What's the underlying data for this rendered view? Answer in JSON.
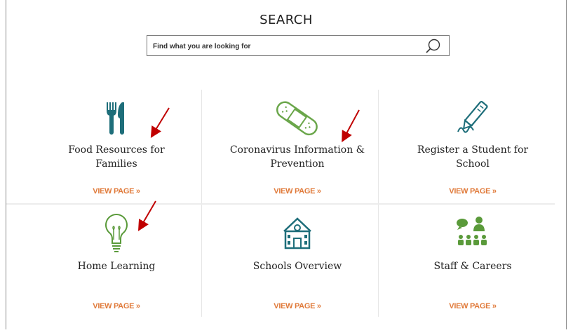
{
  "search": {
    "heading": "SEARCH",
    "placeholder": "Find what you are looking for"
  },
  "tiles": [
    {
      "title_line1": "Food Resources for",
      "title_line2": "Families",
      "link": "VIEW PAGE »",
      "icon": "utensils-icon"
    },
    {
      "title_line1": "Coronavirus Information &",
      "title_line2": "Prevention",
      "link": "VIEW PAGE »",
      "icon": "bandage-icon"
    },
    {
      "title_line1": "Register a Student for",
      "title_line2": "School",
      "link": "VIEW PAGE »",
      "icon": "pen-icon"
    },
    {
      "title_line1": "Home Learning",
      "title_line2": "",
      "link": "VIEW PAGE »",
      "icon": "lightbulb-icon"
    },
    {
      "title_line1": "Schools Overview",
      "title_line2": "",
      "link": "VIEW PAGE »",
      "icon": "school-building-icon"
    },
    {
      "title_line1": "Staff & Careers",
      "title_line2": "",
      "link": "VIEW PAGE »",
      "icon": "staff-group-icon"
    }
  ],
  "colors": {
    "teal": "#1e6e7a",
    "green": "#5a9a3a",
    "orange": "#e07a3a",
    "annotation_red": "#c00000"
  }
}
